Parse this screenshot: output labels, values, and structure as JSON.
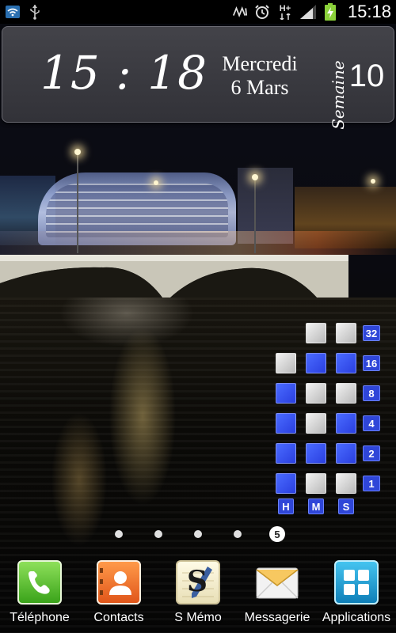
{
  "status_bar": {
    "time": "15:18",
    "icons": [
      "wifi-icon",
      "usb-icon",
      "nfc-icon",
      "alarm-icon",
      "hspa-plus-icon",
      "signal-icon",
      "battery-charging-icon"
    ],
    "network_label": "H+"
  },
  "clock_widget": {
    "time": "15 : 18",
    "day": "Mercredi",
    "date": "6 Mars",
    "week_label": "Semaine",
    "week_number": "10"
  },
  "binary_clock": {
    "weights": [
      "32",
      "16",
      "8",
      "4",
      "2",
      "1"
    ],
    "columns": [
      "H",
      "M",
      "S"
    ],
    "colors": {
      "on": "#2f46d8",
      "off": "#d8d8d8"
    }
  },
  "page_indicator": {
    "total": 5,
    "current": "5"
  },
  "dock": {
    "apps": [
      {
        "label": "Téléphone",
        "icon": "phone-icon"
      },
      {
        "label": "Contacts",
        "icon": "contacts-icon"
      },
      {
        "label": "S Mémo",
        "icon": "s-memo-icon",
        "glyph": "S"
      },
      {
        "label": "Messagerie",
        "icon": "messaging-icon"
      },
      {
        "label": "Applications",
        "icon": "apps-grid-icon"
      }
    ]
  }
}
